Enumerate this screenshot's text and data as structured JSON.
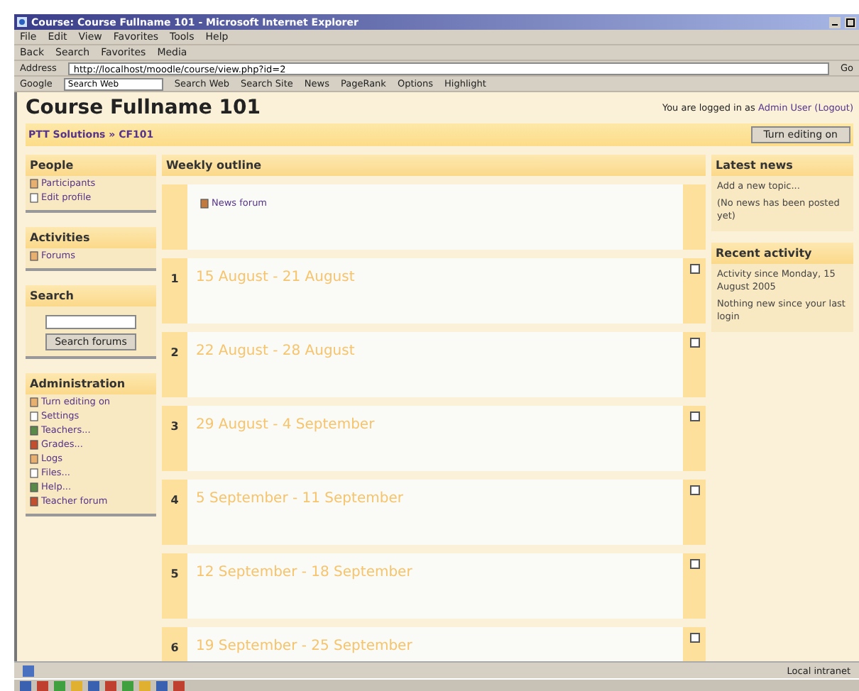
{
  "window": {
    "title": "Course: Course Fullname 101 - Microsoft Internet Explorer"
  },
  "menu_bar": [
    "File",
    "Edit",
    "View",
    "Favorites",
    "Tools",
    "Help"
  ],
  "toolbar": [
    "Back",
    "Search",
    "Favorites",
    "Media"
  ],
  "address_bar": {
    "label": "Address",
    "value": "http://localhost/moodle/course/view.php?id=2",
    "go": "Go"
  },
  "google_bar": {
    "label": "Google",
    "field": "Search Web",
    "buttons": [
      "Search Web",
      "Search Site",
      "News",
      "PageRank",
      "Options",
      "Highlight"
    ]
  },
  "page": {
    "title": "Course Fullname 101",
    "login": {
      "prefix": "You are logged in as",
      "user": "Admin User",
      "logout": "(Logout)"
    },
    "breadcrumb": "PTT Solutions » CF101",
    "edit_button": "Turn editing on"
  },
  "left_blocks": [
    {
      "title": "People",
      "kind": "links",
      "items": [
        "Participants",
        "Edit profile"
      ]
    },
    {
      "title": "Activities",
      "kind": "links",
      "items": [
        "Forums"
      ]
    },
    {
      "title": "Search",
      "kind": "search",
      "button": "Search forums"
    },
    {
      "title": "Administration",
      "kind": "links",
      "items": [
        "Turn editing on",
        "Settings",
        "Teachers...",
        "Grades...",
        "Logs",
        "Files...",
        "Help...",
        "Teacher forum"
      ]
    }
  ],
  "outline": {
    "title": "Weekly outline",
    "sections": [
      {
        "items": [
          "News forum"
        ]
      },
      {
        "number": "1",
        "dates": "15 August - 21 August"
      },
      {
        "number": "2",
        "dates": "22 August - 28 August"
      },
      {
        "number": "3",
        "dates": "29 August - 4 September"
      },
      {
        "number": "4",
        "dates": "5 September - 11 September"
      },
      {
        "number": "5",
        "dates": "12 September - 18 September"
      },
      {
        "number": "6",
        "dates": "19 September - 25 September"
      }
    ]
  },
  "right_blocks": [
    {
      "title": "Latest news",
      "lines": [
        "Add a new topic...",
        "(No news has been posted yet)"
      ]
    },
    {
      "title": "Recent activity",
      "lines": [
        "Activity since Monday, 15 August 2005",
        "Nothing new since your last login"
      ]
    }
  ],
  "status_bar": {
    "zone": "Local intranet"
  }
}
